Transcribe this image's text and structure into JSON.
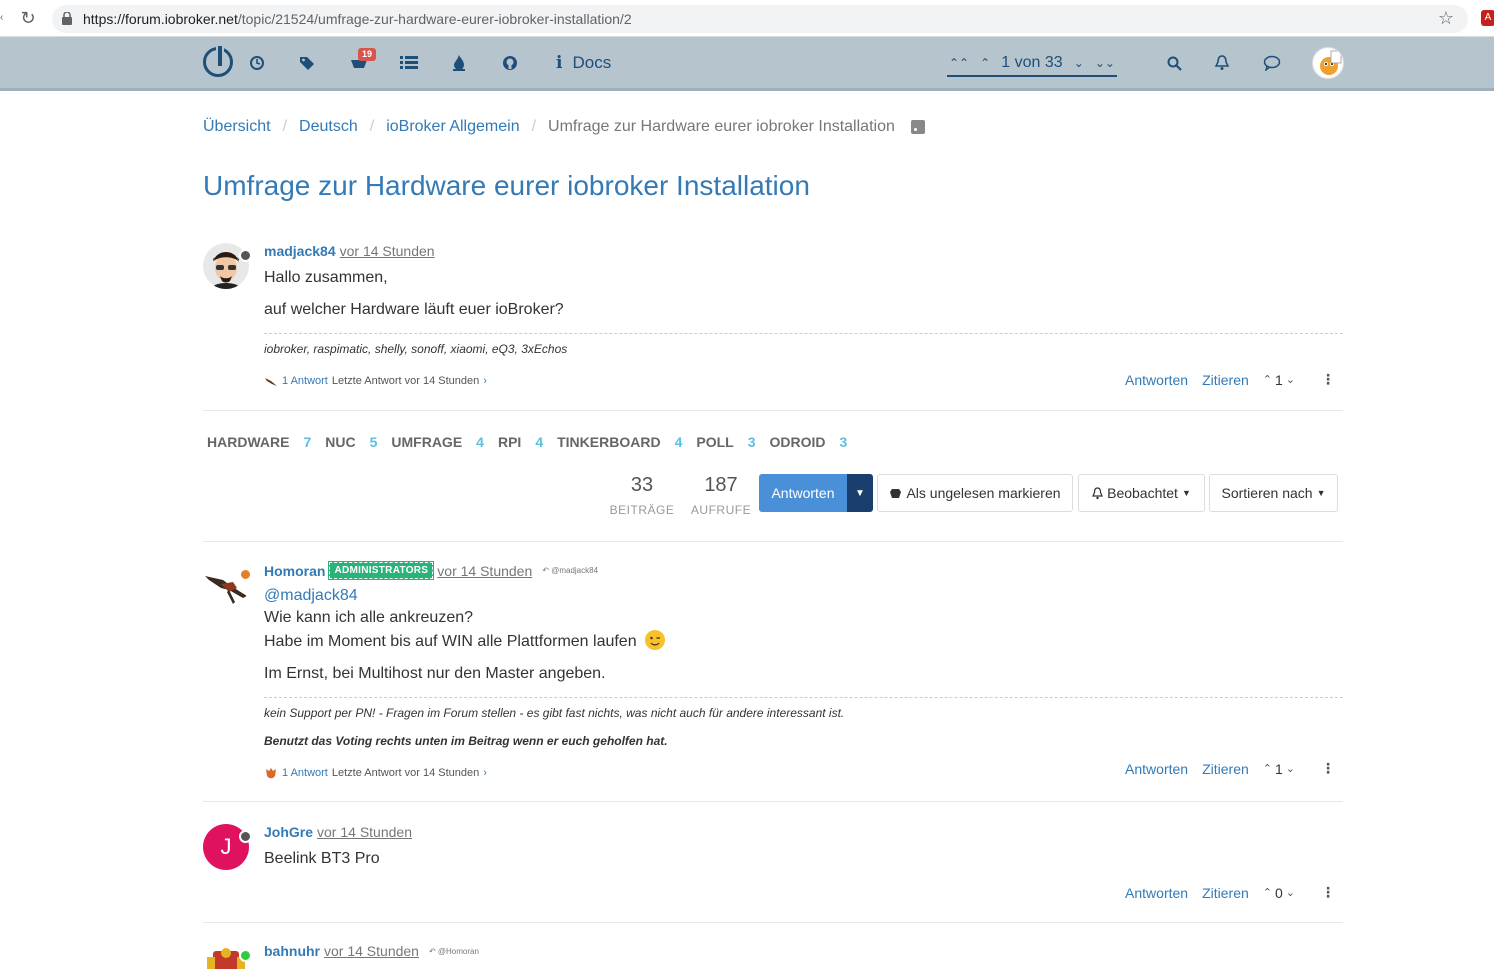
{
  "browser": {
    "url_host": "https://forum.iobroker.net",
    "url_path": "/topic/21524/umfrage-zur-hardware-eurer-iobroker-installation/2"
  },
  "navbar": {
    "notification_count": "19",
    "docs_label": "Docs",
    "pagination_text": "1 von 33"
  },
  "breadcrumb": [
    "Übersicht",
    "Deutsch",
    "ioBroker Allgemein",
    "Umfrage zur Hardware eurer iobroker Installation"
  ],
  "topic_title": "Umfrage zur Hardware eurer iobroker Installation",
  "posts": [
    {
      "user": "madjack84",
      "time": "vor 14 Stunden",
      "lines": [
        "Hallo zusammen,",
        "auf welcher Hardware läuft euer ioBroker?"
      ],
      "signature": "iobroker, raspimatic, shelly, sonoff, xiaomi, eQ3, 3xEchos",
      "replies_count": "1 Antwort",
      "replies_last": "Letzte Antwort vor 14 Stunden",
      "votes": "1"
    },
    {
      "user": "Homoran",
      "badge": "ADMINISTRATORS",
      "time": "vor 14 Stunden",
      "reply_to": "@madjack84",
      "mention": "@madjack84",
      "lines": [
        "Wie kann ich alle ankreuzen?",
        "Habe im Moment bis auf WIN alle Plattformen laufen",
        "Im Ernst, bei Multihost nur den Master angeben."
      ],
      "signature": "kein Support per PN! - Fragen im Forum stellen - es gibt fast nichts, was nicht auch für andere interessant ist.",
      "signature2": "Benutzt das Voting rechts unten im Beitrag wenn er euch geholfen hat.",
      "replies_count": "1 Antwort",
      "replies_last": "Letzte Antwort vor 14 Stunden",
      "votes": "1"
    },
    {
      "user": "JohGre",
      "avatar_letter": "J",
      "time": "vor 14 Stunden",
      "lines": [
        "Beelink BT3 Pro"
      ],
      "votes": "0"
    },
    {
      "user": "bahnuhr",
      "time": "vor 14 Stunden",
      "reply_to": "@Homoran"
    }
  ],
  "actions": {
    "reply": "Antworten",
    "quote": "Zitieren"
  },
  "tags": [
    {
      "name": "HARDWARE",
      "count": "7"
    },
    {
      "name": "NUC",
      "count": "5"
    },
    {
      "name": "UMFRAGE",
      "count": "4"
    },
    {
      "name": "RPI",
      "count": "4"
    },
    {
      "name": "TINKERBOARD",
      "count": "4"
    },
    {
      "name": "POLL",
      "count": "3"
    },
    {
      "name": "ODROID",
      "count": "3"
    }
  ],
  "stats": {
    "posts_num": "33",
    "posts_label": "BEITRÄGE",
    "views_num": "187",
    "views_label": "AUFRUFE"
  },
  "buttons": {
    "reply": "Antworten",
    "mark_unread": "Als ungelesen markieren",
    "watching": "Beobachtet",
    "sort": "Sortieren nach"
  },
  "colors": {
    "navbar": "#b6c4ce",
    "link": "#337ab7",
    "admin_badge": "#2ab27b",
    "reply_button": "#4a90d9"
  }
}
